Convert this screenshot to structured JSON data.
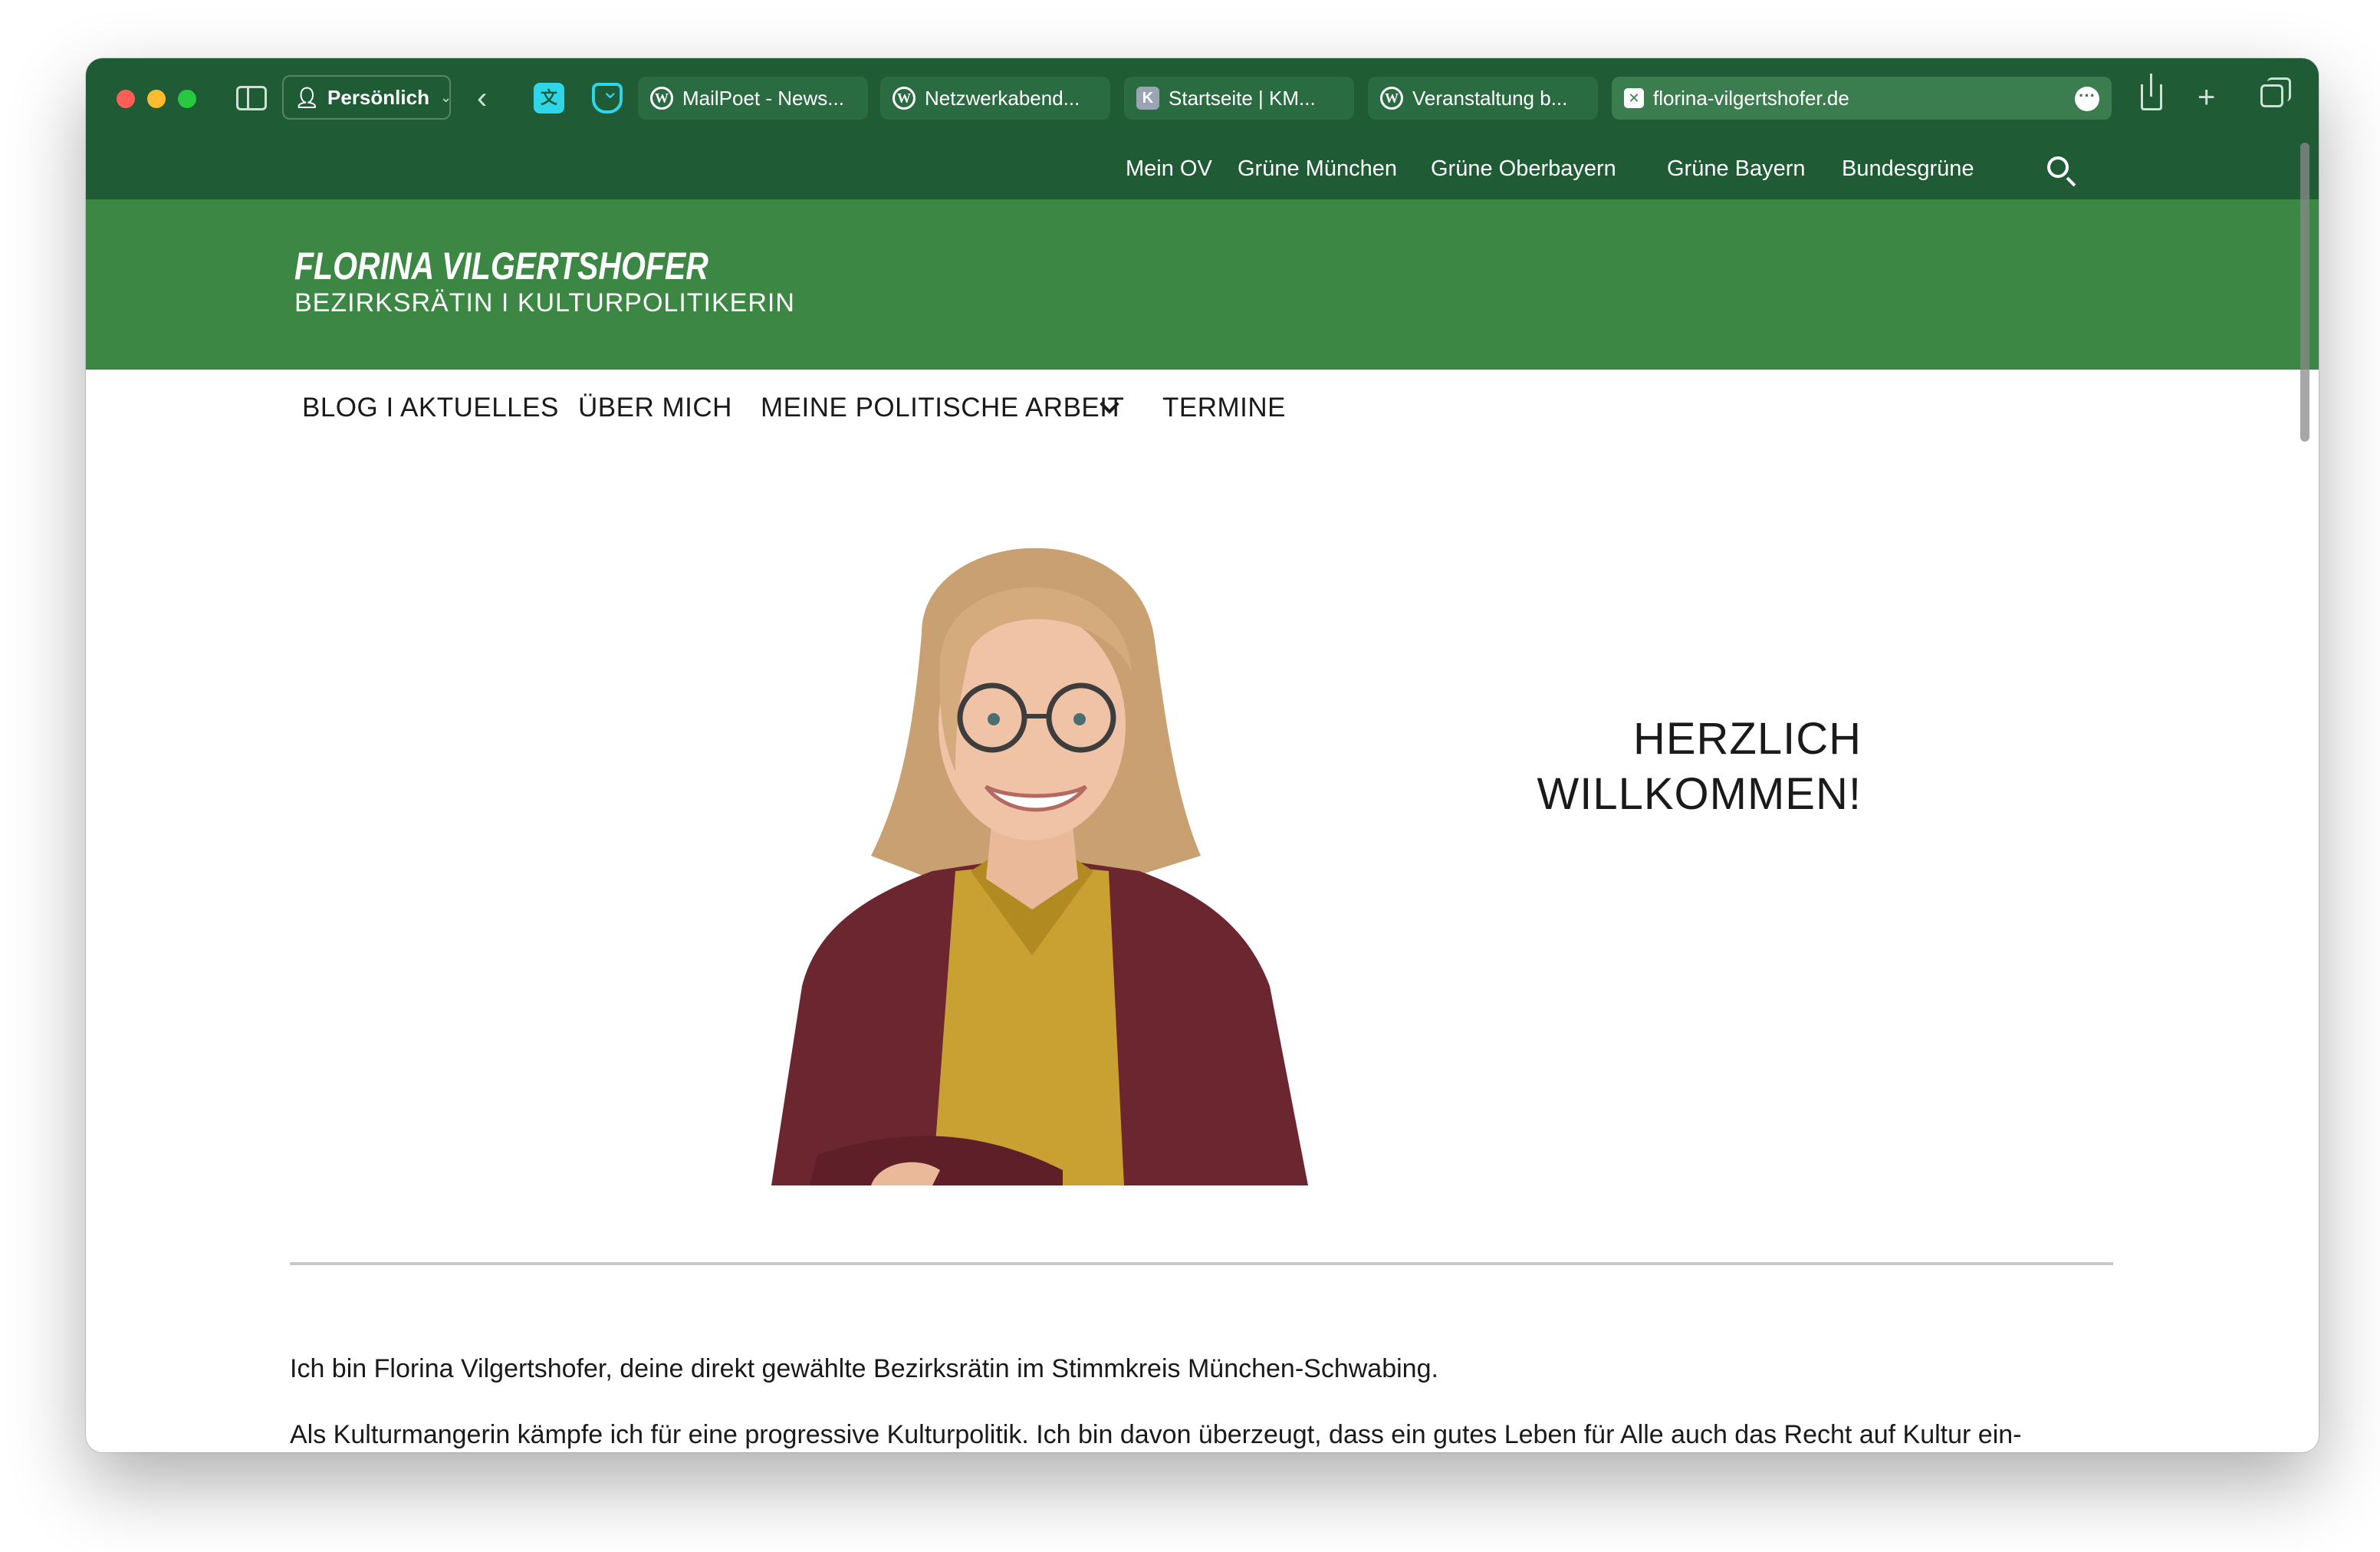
{
  "browser": {
    "profile_label": "Persönlich",
    "tabs": [
      {
        "label": "MailPoet - News..."
      },
      {
        "label": "Netzwerkabend..."
      },
      {
        "label": "Startseite | KM..."
      },
      {
        "label": "Veranstaltung b..."
      },
      {
        "label": "florina-vilgertshofer.de"
      }
    ],
    "active_tab_index": 4,
    "colors": {
      "chrome": "#1f5b35",
      "active_tab": "#3c7d50"
    }
  },
  "meta_nav": {
    "items": [
      "Mein OV",
      "Grüne München",
      "Grüne Oberbayern",
      "Grüne Bayern",
      "Bundesgrüne"
    ]
  },
  "header": {
    "title": "FLORINA VILGERTSHOFER",
    "subtitle": "BEZIRKSRÄTIN I KULTURPOLITIKERIN",
    "background_color": "#3d8744"
  },
  "main_nav": {
    "items": [
      "BLOG I AKTUELLES",
      "ÜBER MICH",
      "MEINE POLITISCHE ARBEIT",
      "TERMINE"
    ]
  },
  "hero": {
    "heading_line1": "HERZLICH",
    "heading_line2": "WILLKOMMEN!"
  },
  "content": {
    "paragraph1": "Ich bin Florina Vilgertshofer, deine direkt gewählte Bezirksrätin im Stimmkreis München-Schwabing.",
    "paragraph2": "Als Kulturmangerin kämpfe ich für eine progressive Kulturpolitik. Ich bin davon überzeugt, dass ein gutes Leben für Alle auch das Recht auf Kultur ein-"
  }
}
